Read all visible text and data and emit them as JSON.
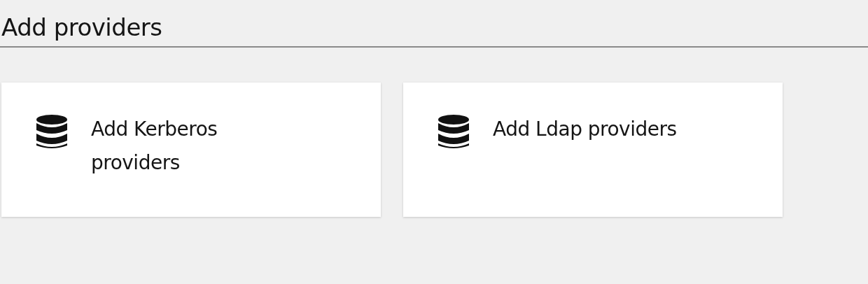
{
  "title": "Add providers",
  "cards": [
    {
      "label": "Add Kerberos providers"
    },
    {
      "label": "Add Ldap providers"
    }
  ]
}
